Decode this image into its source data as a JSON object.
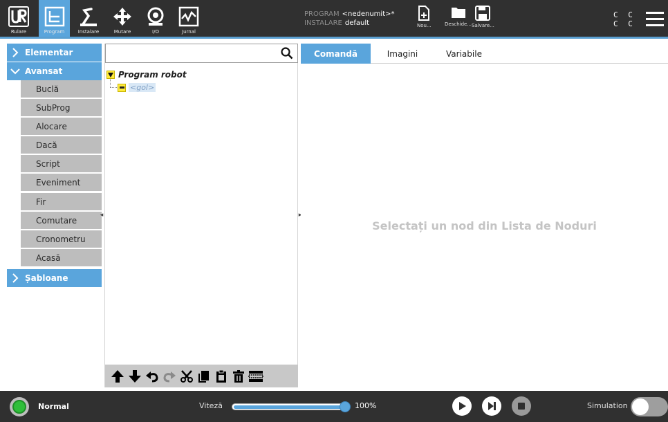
{
  "header": {
    "nav": [
      {
        "label": "Rulare",
        "icon": "ur-logo-icon"
      },
      {
        "label": "Program",
        "icon": "program-icon",
        "active": true
      },
      {
        "label": "Instalare",
        "icon": "installation-icon"
      },
      {
        "label": "Mutare",
        "icon": "move-icon"
      },
      {
        "label": "I/O",
        "icon": "io-icon"
      },
      {
        "label": "Jurnal",
        "icon": "log-icon"
      }
    ],
    "program_key": "PROGRAM",
    "program_value": "<nedenumit>*",
    "installation_key": "INSTALARE",
    "installation_value": "default",
    "file": {
      "new_label": "Nou...",
      "open_label": "Deschide...",
      "save_label": "Salvare..."
    },
    "cc_line1": "C C",
    "cc_line2": "C C"
  },
  "sidebar": {
    "categories": [
      {
        "label": "Elementar",
        "expanded": false
      },
      {
        "label": "Avansat",
        "expanded": true
      },
      {
        "label": "Șabloane",
        "expanded": false
      }
    ],
    "advanced_items": [
      "Buclă",
      "SubProg",
      "Alocare",
      "Dacă",
      "Script",
      "Eveniment",
      "Fir",
      "Comutare",
      "Cronometru",
      "Acasă"
    ]
  },
  "tree": {
    "search_placeholder": "",
    "root_label": "Program robot",
    "child_label": "<gol>"
  },
  "tabs": [
    "Comandă",
    "Imagini",
    "Variabile"
  ],
  "content": {
    "placeholder": "Selectați un nod din Lista de Noduri"
  },
  "footer": {
    "status": "Normal",
    "speed_label": "Viteză",
    "speed_value": "100%",
    "speed_fraction": 1.0,
    "simulation_label": "Simulation"
  },
  "colors": {
    "accent": "#5aa5dc",
    "header_bg": "#303030",
    "status_ok": "#2fbf3a"
  }
}
